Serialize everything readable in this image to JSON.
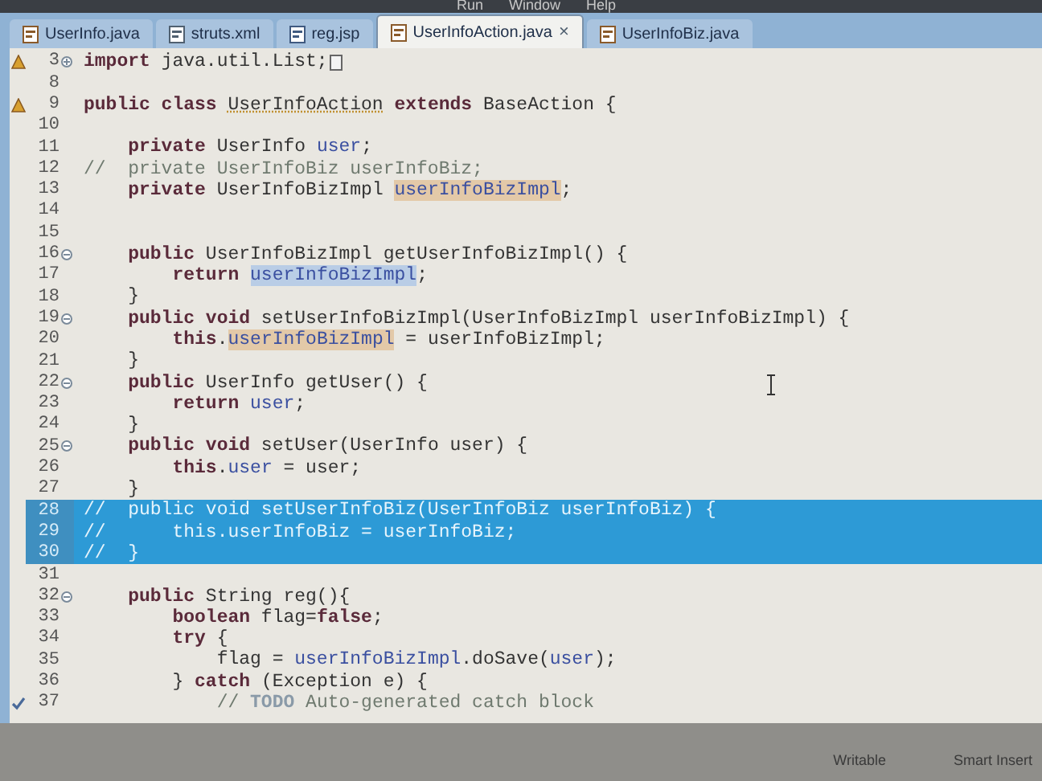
{
  "menu_bar": [
    "Run",
    "Window",
    "Help"
  ],
  "tabs": [
    {
      "label": "UserInfo.java",
      "kind": "java",
      "selected": false
    },
    {
      "label": "struts.xml",
      "kind": "xml",
      "selected": false
    },
    {
      "label": "reg.jsp",
      "kind": "jsp",
      "selected": false
    },
    {
      "label": "UserInfoAction.java",
      "kind": "java",
      "selected": true,
      "close": "×"
    },
    {
      "label": "UserInfoBiz.java",
      "kind": "java",
      "selected": false
    }
  ],
  "lines": [
    {
      "number": "3",
      "expanded": false,
      "warning": true,
      "selected": false,
      "segments": [
        {
          "text": "import ",
          "kind": "keyword"
        },
        {
          "text": "java.util.List;",
          "kind": "plain"
        }
      ]
    },
    {
      "number": "8",
      "selected": false
    },
    {
      "number": "9",
      "warning": true,
      "selected": false,
      "segments": [
        {
          "text": "public class ",
          "kind": "keyword"
        },
        {
          "text": "UserInfoAction",
          "kind": "type_warning"
        },
        {
          "text": " extends ",
          "kind": "keyword"
        },
        {
          "text": "BaseAction {",
          "kind": "plain"
        }
      ]
    },
    {
      "number": "10",
      "selected": false
    },
    {
      "number": "11",
      "selected": false,
      "segments": [
        {
          "text": "    private ",
          "kind": "keyword"
        },
        {
          "text": "UserInfo ",
          "kind": "plain"
        },
        {
          "text": "user",
          "kind": "field"
        },
        {
          "text": ";",
          "kind": "plain"
        }
      ]
    },
    {
      "number": "12",
      "selected": false,
      "segments": [
        {
          "text": "//  private UserInfoBiz userInfoBiz;",
          "kind": "comment"
        }
      ]
    },
    {
      "number": "13",
      "selected": false,
      "segments": [
        {
          "text": "    private ",
          "kind": "keyword"
        },
        {
          "text": "UserInfoBizImpl ",
          "kind": "plain"
        },
        {
          "text": "userInfoBizImpl",
          "kind": "field_write"
        },
        {
          "text": ";",
          "kind": "plain"
        }
      ]
    },
    {
      "number": "14",
      "selected": false
    },
    {
      "number": "15",
      "selected": false
    },
    {
      "number": "16",
      "expanded": true,
      "selected": false,
      "segments": [
        {
          "text": "    public ",
          "kind": "keyword"
        },
        {
          "text": "UserInfoBizImpl getUserInfoBizImpl() {",
          "kind": "plain"
        }
      ]
    },
    {
      "number": "17",
      "selected": false,
      "segments": [
        {
          "text": "        return ",
          "kind": "keyword"
        },
        {
          "text": "userInfoBizImpl",
          "kind": "field_read"
        },
        {
          "text": ";",
          "kind": "plain"
        }
      ]
    },
    {
      "number": "18",
      "selected": false,
      "segments": [
        {
          "text": "    }",
          "kind": "plain"
        }
      ]
    },
    {
      "number": "19",
      "expanded": true,
      "selected": false,
      "segments": [
        {
          "text": "    public void ",
          "kind": "keyword"
        },
        {
          "text": "setUserInfoBizImpl(UserInfoBizImpl userInfoBizImpl) {",
          "kind": "plain"
        }
      ]
    },
    {
      "number": "20",
      "selected": false,
      "segments": [
        {
          "text": "        this",
          "kind": "keyword"
        },
        {
          "text": ".",
          "kind": "plain"
        },
        {
          "text": "userInfoBizImpl",
          "kind": "field_write"
        },
        {
          "text": " = userInfoBizImpl;",
          "kind": "plain"
        }
      ]
    },
    {
      "number": "21",
      "selected": false,
      "segments": [
        {
          "text": "    }",
          "kind": "plain"
        }
      ]
    },
    {
      "number": "22",
      "expanded": true,
      "selected": false,
      "segments": [
        {
          "text": "    public ",
          "kind": "keyword"
        },
        {
          "text": "UserInfo getUser() {",
          "kind": "plain"
        }
      ]
    },
    {
      "number": "23",
      "selected": false,
      "segments": [
        {
          "text": "        return ",
          "kind": "keyword"
        },
        {
          "text": "user",
          "kind": "field"
        },
        {
          "text": ";",
          "kind": "plain"
        }
      ]
    },
    {
      "number": "24",
      "selected": false,
      "segments": [
        {
          "text": "    }",
          "kind": "plain"
        }
      ]
    },
    {
      "number": "25",
      "expanded": true,
      "selected": false,
      "segments": [
        {
          "text": "    public void ",
          "kind": "keyword"
        },
        {
          "text": "setUser(UserInfo user) {",
          "kind": "plain"
        }
      ]
    },
    {
      "number": "26",
      "selected": false,
      "segments": [
        {
          "text": "        this",
          "kind": "keyword"
        },
        {
          "text": ".",
          "kind": "plain"
        },
        {
          "text": "user",
          "kind": "field"
        },
        {
          "text": " = user;",
          "kind": "plain"
        }
      ]
    },
    {
      "number": "27",
      "selected": false,
      "segments": [
        {
          "text": "    }",
          "kind": "plain"
        }
      ]
    },
    {
      "number": "28",
      "selected": true,
      "segments": [
        {
          "text": "//  public void setUserInfoBiz(UserInfoBiz userInfoBiz) {",
          "kind": "comment"
        }
      ]
    },
    {
      "number": "29",
      "selected": true,
      "segments": [
        {
          "text": "//      this.userInfoBiz = userInfoBiz;",
          "kind": "comment"
        }
      ]
    },
    {
      "number": "30",
      "selected": true,
      "segments": [
        {
          "text": "//  }",
          "kind": "comment"
        }
      ]
    },
    {
      "number": "31",
      "selected": false
    },
    {
      "number": "32",
      "expanded": true,
      "selected": false,
      "segments": [
        {
          "text": "    public ",
          "kind": "keyword"
        },
        {
          "text": "String reg(){",
          "kind": "plain"
        }
      ]
    },
    {
      "number": "33",
      "selected": false,
      "segments": [
        {
          "text": "        boolean ",
          "kind": "keyword"
        },
        {
          "text": "flag=",
          "kind": "plain"
        },
        {
          "text": "false",
          "kind": "keyword"
        },
        {
          "text": ";",
          "kind": "plain"
        }
      ]
    },
    {
      "number": "34",
      "selected": false,
      "segments": [
        {
          "text": "        try ",
          "kind": "keyword"
        },
        {
          "text": "{",
          "kind": "plain"
        }
      ]
    },
    {
      "number": "35",
      "selected": false,
      "segments": [
        {
          "text": "            flag = ",
          "kind": "plain"
        },
        {
          "text": "userInfoBizImpl",
          "kind": "field"
        },
        {
          "text": ".doSave(",
          "kind": "plain"
        },
        {
          "text": "user",
          "kind": "field"
        },
        {
          "text": ");",
          "kind": "plain"
        }
      ]
    },
    {
      "number": "36",
      "selected": false,
      "segments": [
        {
          "text": "        } ",
          "kind": "plain"
        },
        {
          "text": "catch ",
          "kind": "keyword"
        },
        {
          "text": "(Exception e) {",
          "kind": "plain"
        }
      ]
    },
    {
      "number": "37",
      "task": true,
      "selected": false,
      "segments": [
        {
          "text": "            // ",
          "kind": "comment"
        },
        {
          "text": "TODO",
          "kind": "todo"
        },
        {
          "text": " Auto-generated catch block",
          "kind": "comment"
        }
      ]
    }
  ],
  "status_bar": [
    "Writable",
    "Smart Insert"
  ]
}
